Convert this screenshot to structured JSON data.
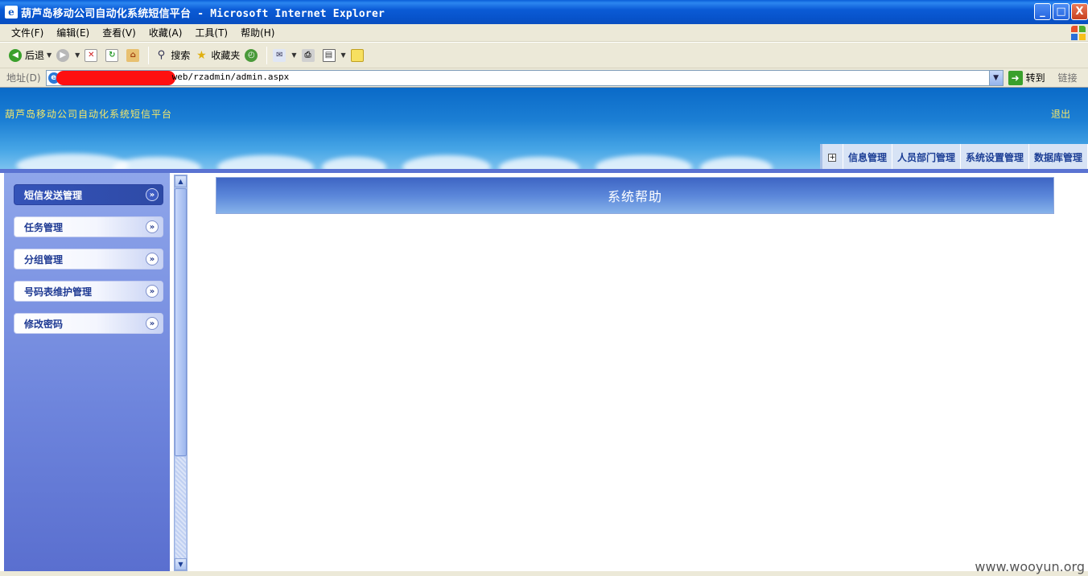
{
  "window": {
    "title": "葫芦岛移动公司自动化系统短信平台 - Microsoft Internet Explorer",
    "buttons": {
      "minimize": "_",
      "maximize": "□",
      "close": "X"
    }
  },
  "menubar": {
    "items": [
      "文件(F)",
      "编辑(E)",
      "查看(V)",
      "收藏(A)",
      "工具(T)",
      "帮助(H)"
    ]
  },
  "toolbar": {
    "back_label": "后退",
    "search_label": "搜索",
    "favorites_label": "收藏夹"
  },
  "address": {
    "label": "地址(D)",
    "url_visible": "web/rzadmin/admin.aspx",
    "go_label": "转到",
    "links_label": "链接"
  },
  "page": {
    "site_title": "葫芦岛移动公司自动化系统短信平台",
    "logout_label": "退出",
    "topnav": {
      "expand_symbol": "+",
      "items": [
        "信息管理",
        "人员部门管理",
        "系统设置管理",
        "数据库管理"
      ]
    },
    "sidebar": {
      "items": [
        {
          "label": "短信发送管理",
          "active": true
        },
        {
          "label": "任务管理",
          "active": false
        },
        {
          "label": "分组管理",
          "active": false
        },
        {
          "label": "号码表维护管理",
          "active": false
        },
        {
          "label": "修改密码",
          "active": false
        }
      ]
    },
    "main_title": "系统帮助"
  },
  "watermark": "www.wooyun.org",
  "colors": {
    "titlebar": "#0b5bd6",
    "banner_top": "#0a6ac8",
    "banner_text": "#f5e86a",
    "sidebar_bg": "#6d84dc",
    "sidebar_active": "#3453b8",
    "redaction": "#ff1010",
    "main_header": "#5a86d9"
  }
}
